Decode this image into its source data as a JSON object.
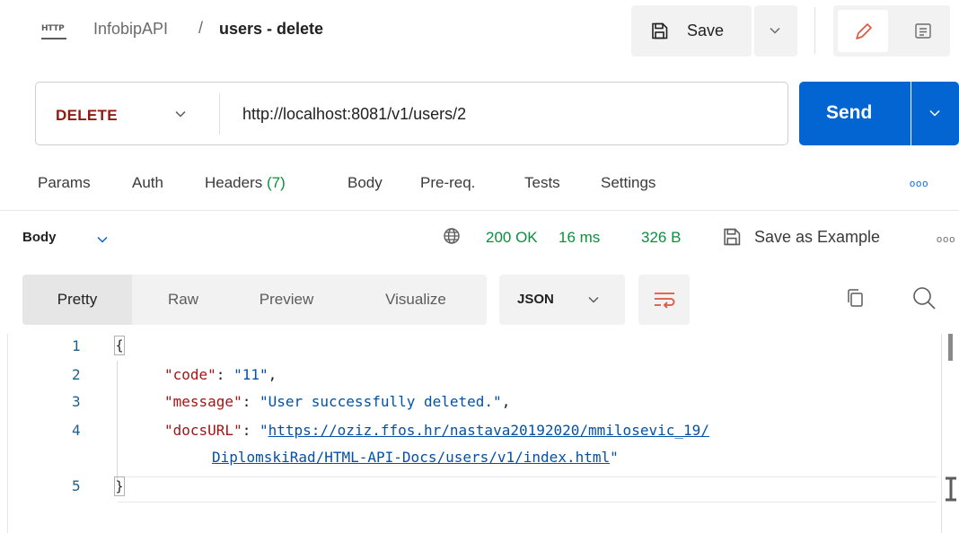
{
  "breadcrumb": {
    "icon": "http-icon",
    "icon_text": "HTTP",
    "collection": "InfobipAPI",
    "separator": "/",
    "request": "users - delete"
  },
  "toolbar": {
    "save_label": "Save"
  },
  "request": {
    "method": "DELETE",
    "url": "http://localhost:8081/v1/users/2",
    "send_label": "Send"
  },
  "request_tabs": [
    {
      "label": "Params"
    },
    {
      "label": "Auth"
    },
    {
      "label": "Headers",
      "count": "(7)"
    },
    {
      "label": "Body"
    },
    {
      "label": "Pre-req."
    },
    {
      "label": "Tests"
    },
    {
      "label": "Settings"
    }
  ],
  "response": {
    "section_label": "Body",
    "status": "200 OK",
    "time": "16 ms",
    "size": "326 B",
    "save_example_label": "Save as Example",
    "view_tabs": [
      "Pretty",
      "Raw",
      "Preview",
      "Visualize"
    ],
    "active_view": "Pretty",
    "format": "JSON"
  },
  "code": {
    "line_numbers": [
      "1",
      "2",
      "3",
      "4",
      "5"
    ],
    "open_brace": "{",
    "close_brace": "}",
    "code_key": "\"code\"",
    "code_value": "\"11\"",
    "message_key": "\"message\"",
    "message_value": "\"User successfully deleted.\"",
    "docs_key": "\"docsURL\"",
    "docs_url_part1": "https://oziz.ffos.hr/nastava20192020/mmilosevic_19/",
    "docs_url_part2": "DiplomskiRad/HTML-API-Docs/users/v1/index.html"
  },
  "colors": {
    "method": "#8e1a10",
    "send": "#0265d2",
    "status": "#0a8f3c",
    "json_key": "#a31515",
    "json_string": "#0451a5"
  }
}
